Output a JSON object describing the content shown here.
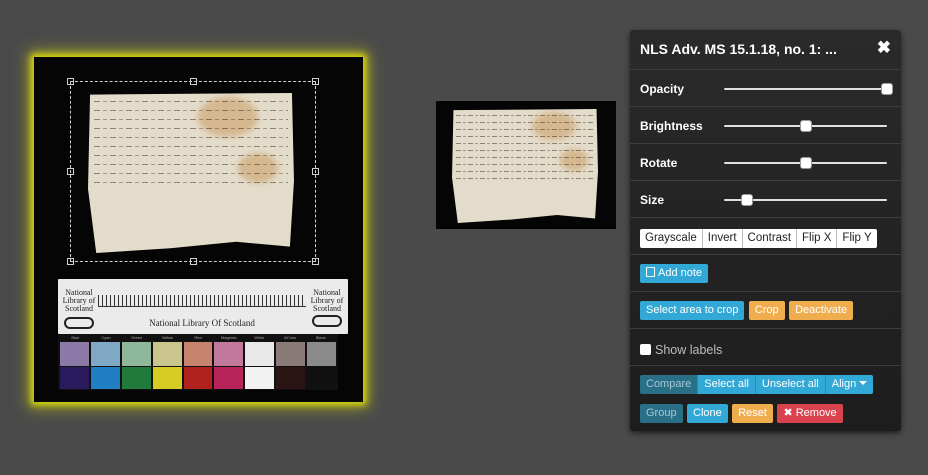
{
  "panel": {
    "title": "NLS Adv. MS 15.1.18, no. 1: ...",
    "close_symbol": "✖",
    "sliders": [
      {
        "label": "Opacity",
        "value": 1.0
      },
      {
        "label": "Brightness",
        "value": 0.5
      },
      {
        "label": "Rotate",
        "value": 0.5
      },
      {
        "label": "Size",
        "value": 0.14
      }
    ],
    "filters": [
      "Grayscale",
      "Invert",
      "Contrast",
      "Flip X",
      "Flip Y"
    ],
    "add_note": "Add note",
    "crop": {
      "select": "Select area to crop",
      "crop": "Crop",
      "deactivate": "Deactivate"
    },
    "show_labels": "Show labels",
    "compare": "Compare",
    "select_all": "Select all",
    "unselect_all": "Unselect all",
    "align": "Align",
    "group": "Group",
    "clone": "Clone",
    "reset": "Reset",
    "remove": "Remove",
    "remove_symbol": "✖"
  },
  "color_card": {
    "labels": [
      "Blue",
      "Cyan",
      "Green",
      "Yellow",
      "Red",
      "Magenta",
      "White",
      "3/Color",
      "Black"
    ],
    "light": [
      "#8b7aa8",
      "#7fa8c4",
      "#8fb79a",
      "#c9c58d",
      "#c8836e",
      "#c2789a",
      "#e8e8e8",
      "#8a7a78",
      "#8a8a8a"
    ],
    "dark": [
      "#2a1a5e",
      "#1f7fc2",
      "#1f7a3c",
      "#d6cc22",
      "#b0201c",
      "#b8245a",
      "#f2f2f2",
      "#2a1414",
      "#111111"
    ]
  },
  "ruler_card": {
    "library_text": "National Library of Scotland",
    "title": "National Library Of Scotland"
  },
  "colors": {
    "highlight": "#d6d60f",
    "blue": "#31a8d6",
    "orange": "#f0ad4e",
    "red": "#d9434d"
  }
}
